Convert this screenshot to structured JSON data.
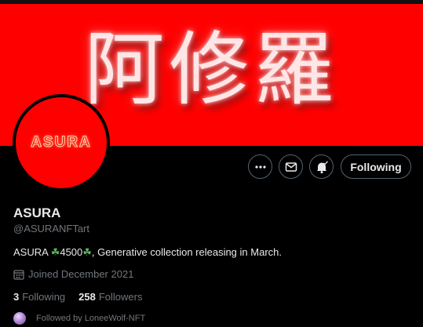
{
  "banner": {
    "text": "阿修羅",
    "background": "#ff0000"
  },
  "avatar": {
    "logo_text": "ASURA",
    "background": "#ff0000"
  },
  "actions": {
    "more_icon": "more-horizontal-icon",
    "message_icon": "envelope-icon",
    "notify_icon": "bell-check-icon",
    "follow_label": "Following"
  },
  "profile": {
    "display_name": "ASURA",
    "handle": "@ASURANFTart",
    "bio_prefix": "ASURA ",
    "clover": "☘",
    "bio_number": "4500",
    "bio_suffix": ", Generative collection releasing in March.",
    "joined": "Joined December 2021"
  },
  "stats": {
    "following_count": "3",
    "following_label": "Following",
    "followers_count": "258",
    "followers_label": "Followers"
  },
  "followed_by": {
    "text": "Followed by LoneeWolf-NFT"
  },
  "colors": {
    "muted": "#71767b",
    "text": "#e7e9ea",
    "border": "#536471"
  }
}
